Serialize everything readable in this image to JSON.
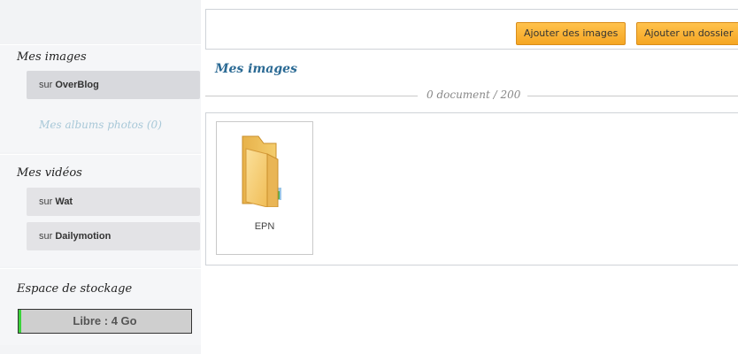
{
  "sidebar": {
    "images_title": "Mes images",
    "images_item": {
      "prefix": "sur ",
      "name": "OverBlog"
    },
    "albums_link": "Mes albums photos (0)",
    "videos_title": "Mes vidéos",
    "videos_items": [
      {
        "prefix": "sur ",
        "name": "Wat"
      },
      {
        "prefix": "sur ",
        "name": "Dailymotion"
      }
    ],
    "storage_title": "Espace de stockage",
    "storage_label": "Libre : 4 Go",
    "storage_used_fraction": 0.015
  },
  "toolbar": {
    "add_images_label": "Ajouter des images",
    "add_folder_label": "Ajouter un dossier"
  },
  "main": {
    "title": "Mes images",
    "doc_count": "0 document / 200",
    "folders": [
      {
        "name": "EPN"
      }
    ]
  },
  "colors": {
    "accent_button": "#f5a623",
    "title_blue": "#2b6a94",
    "storage_fill": "#3bd33b"
  }
}
